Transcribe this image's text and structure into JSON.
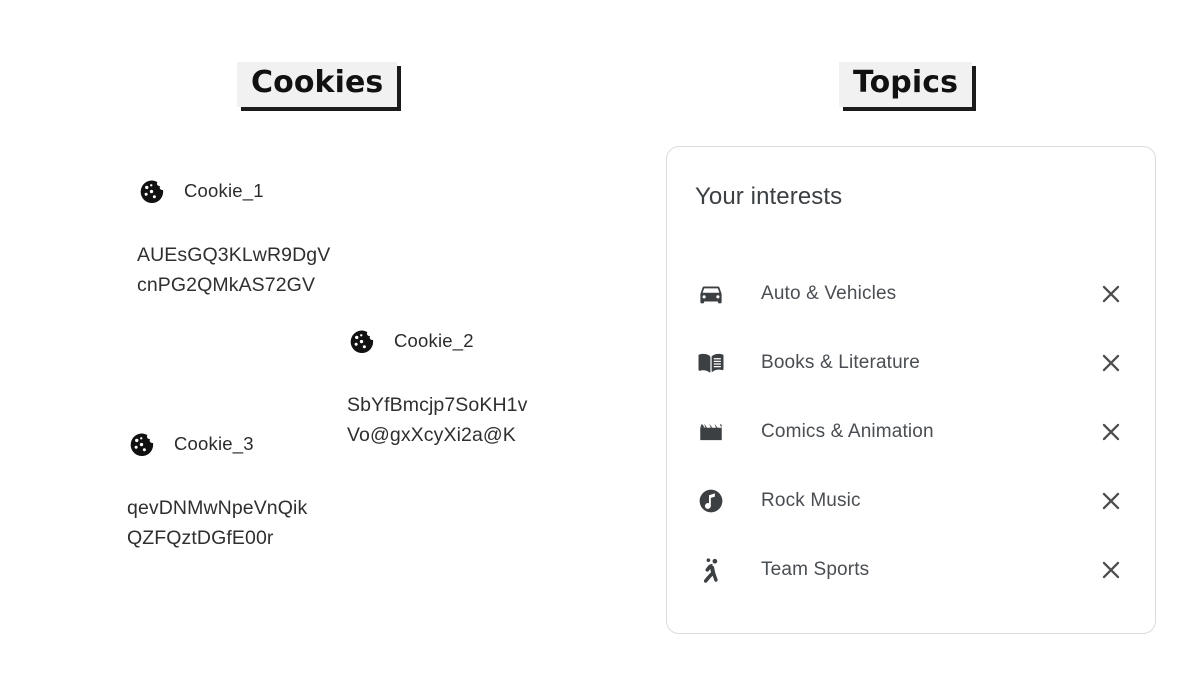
{
  "headings": {
    "cookies": "Cookies",
    "topics": "Topics"
  },
  "cookies_panel": {
    "icon": "cookie-icon",
    "cards": [
      {
        "title": "Cookie_1",
        "value_line1": "AUEsGQ3KLwR9DgV",
        "value_line2": "cnPG2QMkAS72GV"
      },
      {
        "title": "Cookie_2",
        "value_line1": "SbYfBmcjp7SoKH1v",
        "value_line2": "Vo@gxXcyXi2a@K"
      },
      {
        "title": "Cookie_3",
        "value_line1": "qevDNMwNpeVnQik",
        "value_line2": "QZFQztDGfE00r"
      }
    ],
    "background_card_count": 5
  },
  "topics_panel": {
    "title": "Your interests",
    "remove_icon": "close-icon",
    "items": [
      {
        "label": "Auto & Vehicles",
        "icon": "car-icon"
      },
      {
        "label": "Books & Literature",
        "icon": "book-icon"
      },
      {
        "label": "Comics & Animation",
        "icon": "clapperboard-icon"
      },
      {
        "label": "Rock Music",
        "icon": "music-note-icon"
      },
      {
        "label": "Team Sports",
        "icon": "handball-player-icon"
      }
    ]
  },
  "colors": {
    "card_border": "#d8dade",
    "panel_border": "#dadce0",
    "heading_bg": "#f1f1f1",
    "heading_shadow": "#1b1b1b",
    "text_primary": "#2f2f2f",
    "text_secondary": "#4a4e52",
    "icon_fill": "#3c4043",
    "background": "#ffffff"
  }
}
